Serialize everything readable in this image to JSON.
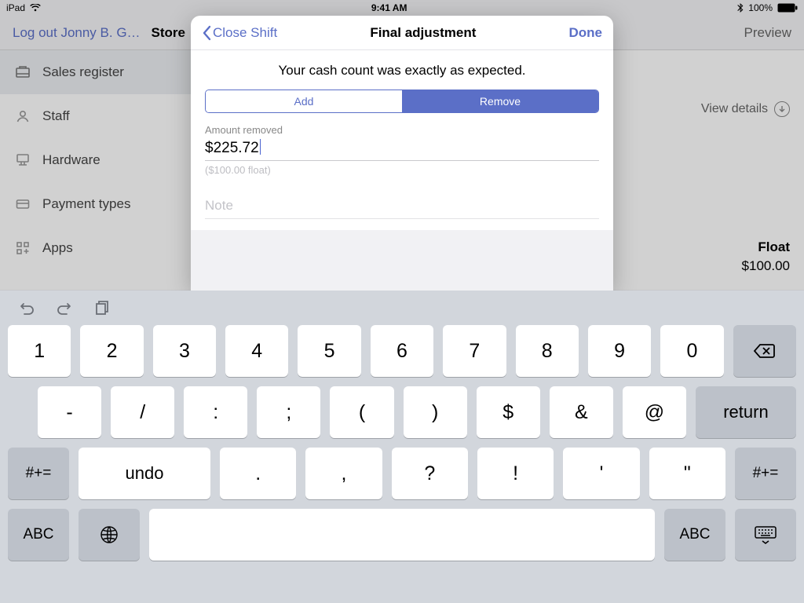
{
  "status": {
    "device": "iPad",
    "time": "9:41 AM",
    "battery": "100%"
  },
  "nav": {
    "logout": "Log out Jonny B. G…",
    "store": "Store",
    "preview": "Preview"
  },
  "sidebar": {
    "items": [
      {
        "label": "Sales register"
      },
      {
        "label": "Staff"
      },
      {
        "label": "Hardware"
      },
      {
        "label": "Payment types"
      },
      {
        "label": "Apps"
      }
    ]
  },
  "main": {
    "view_details": "View details",
    "float_label": "Float",
    "float_value": "$100.00"
  },
  "modal": {
    "back": "Close Shift",
    "title": "Final adjustment",
    "done": "Done",
    "message": "Your cash count was exactly as expected.",
    "seg_add": "Add",
    "seg_remove": "Remove",
    "amount_label": "Amount removed",
    "amount_value": "$225.72",
    "amount_hint": "($100.00 float)",
    "note_placeholder": "Note"
  },
  "keyboard": {
    "row1": [
      "1",
      "2",
      "3",
      "4",
      "5",
      "6",
      "7",
      "8",
      "9",
      "0"
    ],
    "row2": [
      "-",
      "/",
      ":",
      ";",
      "(",
      ")",
      "$",
      "&",
      "@"
    ],
    "return": "return",
    "sym": "#+=",
    "undo": "undo",
    "row3": [
      ".",
      ",",
      "?",
      "!",
      "'",
      "\""
    ],
    "abc": "ABC"
  }
}
